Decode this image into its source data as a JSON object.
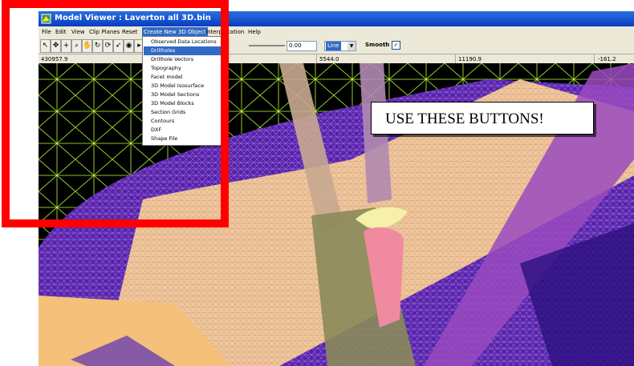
{
  "window": {
    "title": "Model Viewer : Laverton all 3D.bin"
  },
  "menu": {
    "items": [
      "File",
      "Edit",
      "View",
      "Clip Planes",
      "Reset",
      "Create New 3D Object",
      "Interpretation",
      "Help"
    ],
    "active_index": 5,
    "dropdown": {
      "items": [
        "Observed Data Locations",
        "Drillholes",
        "Drillhole Vectors",
        "Topography",
        "Facet model",
        "3D Model Isosurface",
        "3D Model Sections",
        "3D Model Blocks",
        "Section Grids",
        "Contours",
        "DXF",
        "Shape File"
      ],
      "selected_index": 1
    }
  },
  "toolbar": {
    "value_input": "0.00",
    "render_mode": "Line",
    "smooth_label": "Smooth",
    "smooth_checked": true
  },
  "coordinates": {
    "x": "430957.9",
    "y": "5544.0",
    "z": "11190.9",
    "w": "-161.2"
  },
  "annotation": {
    "text": "USE THESE BUTTONS!"
  },
  "colors": {
    "highlight": "#ff0000",
    "title_bar": "#0a3cc0",
    "menu_selection": "#316ac5",
    "mesh_lines": "#b8ff3a",
    "layer_purple": "#5a1fb0",
    "layer_peach": "#f5c08a"
  }
}
